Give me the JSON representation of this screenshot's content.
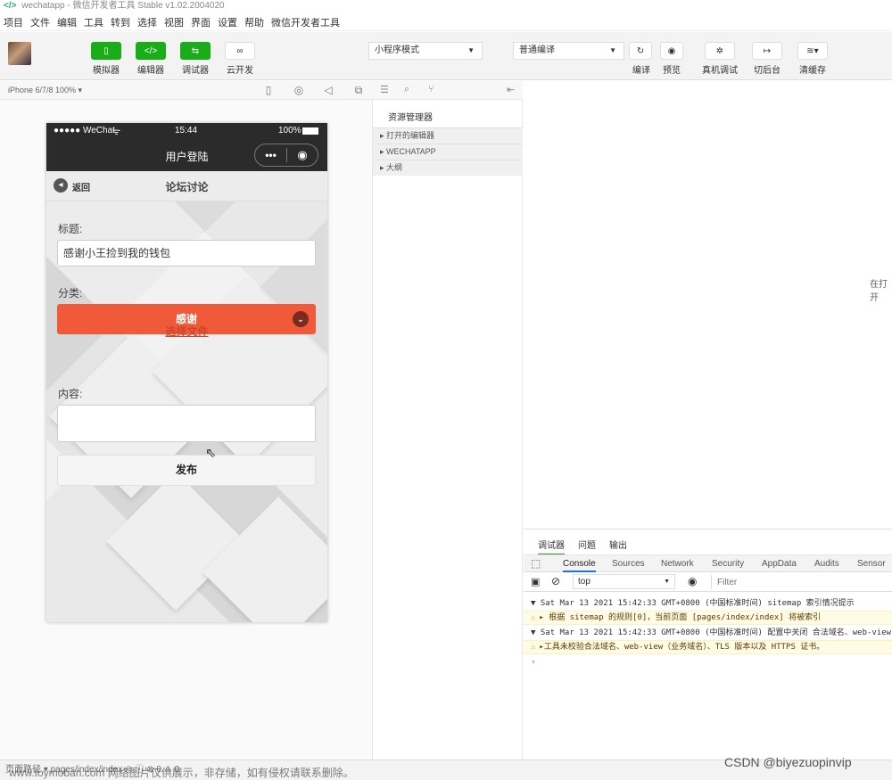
{
  "titlebar": {
    "text": "wechatapp - 微信开发者工具 Stable v1.02.2004020"
  },
  "menu": [
    "项目",
    "文件",
    "编辑",
    "工具",
    "转到",
    "选择",
    "视图",
    "界面",
    "设置",
    "帮助",
    "微信开发者工具"
  ],
  "toolbar": {
    "simulator": "模拟器",
    "editor": "编辑器",
    "debugger": "调试器",
    "cloud": "云开发",
    "mode": "小程序模式",
    "compile_mode": "普通编译",
    "compile": "编译",
    "preview": "预览",
    "realdebug": "真机调试",
    "backend": "切后台",
    "clearcache": "清缓存"
  },
  "simhead": {
    "device": "iPhone 6/7/8 100% ▾"
  },
  "phone": {
    "carrier": "●●●●● WeChat",
    "time": "15:44",
    "battery": "100%",
    "nav_title": "用户登陆",
    "capsule_more": "•••",
    "capsule_close": "◉",
    "back_label": "返回",
    "page_title": "论坛讨论",
    "title_label": "标题:",
    "title_value": "感谢小王捡到我的钱包",
    "category_label": "分类:",
    "category_value": "感谢",
    "file_link": "选择文件",
    "content_label": "内容:",
    "publish": "发布"
  },
  "explorer": {
    "title": "资源管理器",
    "rows": [
      "▸ 打开的编辑器",
      "▸ WECHATAPP",
      "▸ 大纲"
    ]
  },
  "editor_hint": "在打开",
  "devtools": {
    "top_tabs": [
      "调试器",
      "问题",
      "输出"
    ],
    "tabs": [
      "Console",
      "Sources",
      "Network",
      "Security",
      "AppData",
      "Audits",
      "Sensor"
    ],
    "context": "top",
    "filter_placeholder": "Filter",
    "logs": [
      "▼ Sat Mar 13 2021 15:42:33 GMT+0800 (中国标准时间) sitemap 索引情况提示",
      "▸ 根据 sitemap 的规则[0]，当前页面 [pages/index/index] 将被索引",
      "▼ Sat Mar 13 2021 15:42:33 GMT+0800 (中国标准时间) 配置中关闭 合法域名、web-view",
      "▸工具未校验合法域名、web-view（业务域名）、TLS 版本以及 HTTPS 证书。"
    ],
    "prompt": "›"
  },
  "bottombar": {
    "text": "页面路径 ▾  pages/index/index  ◎   ⓘ   ⊗ 0 ⚠ 0"
  },
  "watermark": "CSDN @biyezuopinvip",
  "overlay_watermark": "www.toymoban.com 网络图片仅供展示，非存储，如有侵权请联系删除。",
  "colors": {
    "green": "#1aad19",
    "orange": "#f05a3a",
    "dark": "#2b2b2b"
  }
}
